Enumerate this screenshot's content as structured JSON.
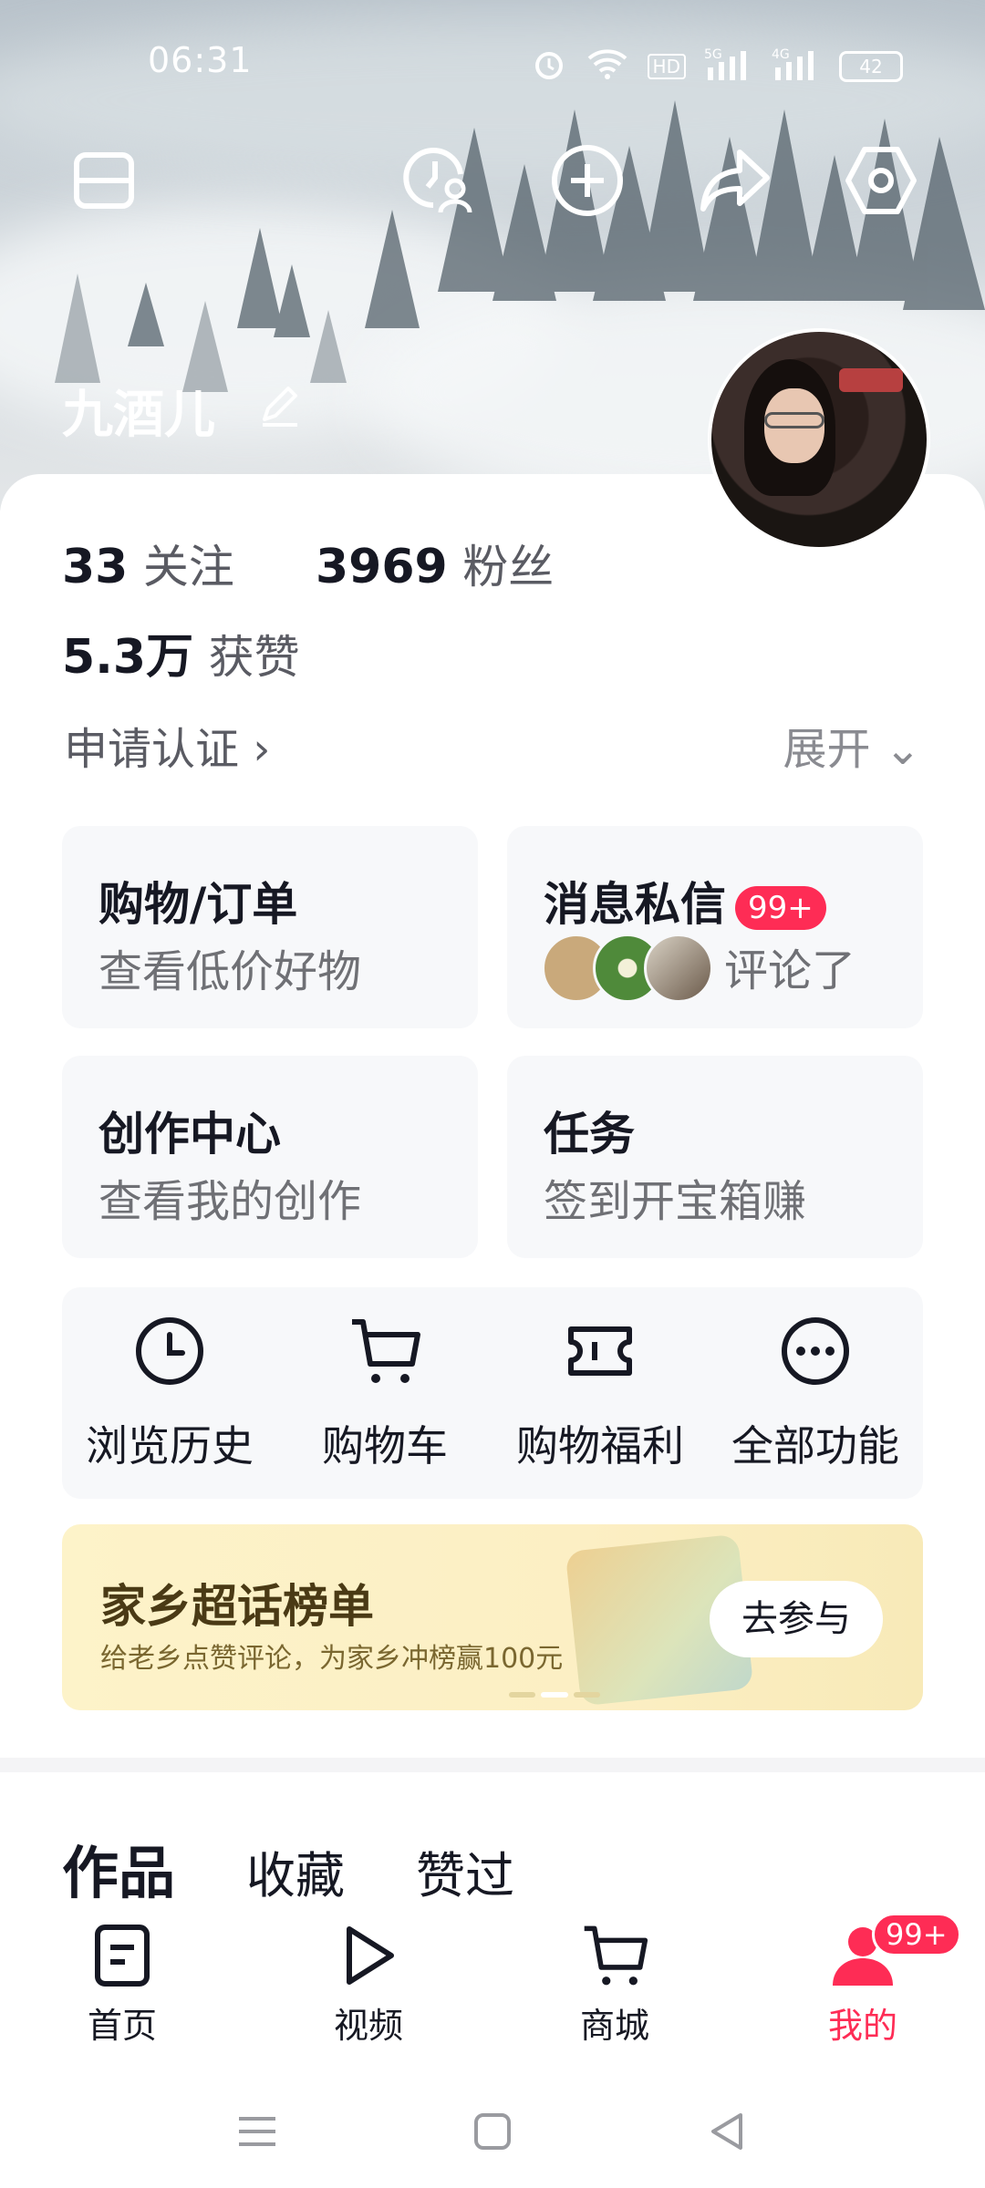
{
  "status_bar": {
    "time": "06:31",
    "battery": "42"
  },
  "profile": {
    "username": "九酒儿",
    "following_count": "33",
    "following_label": "关注",
    "followers_count": "3969",
    "followers_label": "粉丝",
    "likes_count": "5.3万",
    "likes_label": "获赞",
    "verify_label": "申请认证 ›",
    "expand_label": "展开 ⌄"
  },
  "tiles": [
    {
      "title": "购物/订单",
      "subtitle": "查看低价好物"
    },
    {
      "title": "消息私信",
      "badge": "99+",
      "subtitle": "评论了"
    },
    {
      "title": "创作中心",
      "subtitle": "查看我的创作"
    },
    {
      "title": "任务",
      "subtitle": "签到开宝箱赚"
    }
  ],
  "tools": [
    {
      "label": "浏览历史",
      "icon": "clock-icon"
    },
    {
      "label": "购物车",
      "icon": "cart-icon"
    },
    {
      "label": "购物福利",
      "icon": "coupon-icon"
    },
    {
      "label": "全部功能",
      "icon": "more-icon"
    }
  ],
  "banner": {
    "title": "家乡超话榜单",
    "subtitle": "给老乡点赞评论，为家乡冲榜赢100元",
    "button": "去参与"
  },
  "content_tabs": [
    "作品",
    "收藏",
    "赞过"
  ],
  "bottom_nav": [
    {
      "label": "首页",
      "icon": "home-icon"
    },
    {
      "label": "视频",
      "icon": "play-icon"
    },
    {
      "label": "商城",
      "icon": "cart-icon"
    },
    {
      "label": "我的",
      "icon": "person-icon",
      "badge": "99+"
    }
  ],
  "colors": {
    "accent": "#fe2c55",
    "text": "#161823",
    "tile_bg": "#f7f8fa"
  }
}
